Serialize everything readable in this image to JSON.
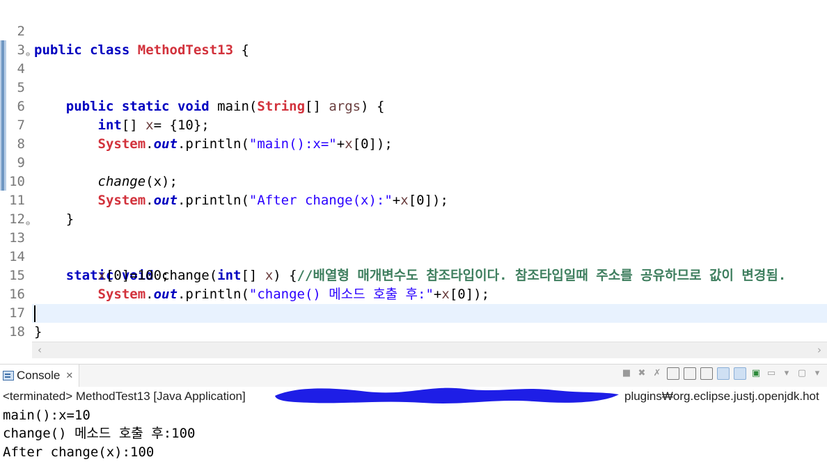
{
  "editor": {
    "lines": [
      {
        "num": "2"
      },
      {
        "num": "3"
      },
      {
        "num": "4"
      },
      {
        "num": "5"
      },
      {
        "num": "6"
      },
      {
        "num": "7"
      },
      {
        "num": "8"
      },
      {
        "num": "9"
      },
      {
        "num": "10"
      },
      {
        "num": "11"
      },
      {
        "num": "12"
      },
      {
        "num": "13"
      },
      {
        "num": "14"
      },
      {
        "num": "15"
      },
      {
        "num": "16"
      },
      {
        "num": "17"
      },
      {
        "num": "18"
      }
    ],
    "t": {
      "public": "public",
      "class": "class",
      "classname": "MethodTest13",
      "brace_open": " {",
      "static": "static",
      "void": "void",
      "main": "main(",
      "String": "String",
      "args_tail": "[] ",
      "args": "args",
      "main_close": ") {",
      "int": "int",
      "decl_tail": "[] ",
      "x": "x",
      "decl_value": "= {10};",
      "System": "System",
      "dot": ".",
      "out": "out",
      "println": ".println(",
      "str_main": "\"main():x=\"",
      "plus_x0": "+",
      "x0": "[0]);",
      "change_call": "change",
      "change_args": "(x);",
      "str_after": "\"After change(x):\"",
      "close_brace": "}",
      "change_decl": "change(",
      "int_param": "int",
      "param_tail": "[] ",
      "param_close": ") {",
      "comment": "//배열형 매개변수도 참조타입이다. 참조타입일때 주소를 공유하므로 값이 변경됨.",
      "assign": "[0]=100;",
      "str_change": "\"change() 메소드 호출 후:\""
    }
  },
  "console": {
    "tab_label": "Console",
    "tab_close": "✕",
    "status_left": "<terminated> MethodTest13 [Java Application]",
    "status_right": "plugins₩org.eclipse.justj.openjdk.hot",
    "output": [
      "main():x=10",
      "change() 메소드 호출 후:100",
      "After change(x):100"
    ],
    "toolbar_icons": [
      "terminate-icon",
      "remove-launch-icon",
      "remove-all-icon",
      "clear-console-icon",
      "scroll-lock-icon",
      "word-wrap-icon",
      "show-on-stdout-icon",
      "show-on-stderr-icon",
      "pin-console-icon",
      "display-selected-console-icon",
      "dropdown-icon",
      "open-console-icon",
      "dropdown-icon"
    ]
  },
  "colors": {
    "keyword": "#7f0055",
    "string": "#2a00ff",
    "comment": "#3f7f5f",
    "current_line": "#e8f2fe",
    "redaction": "#1e1ee6"
  }
}
